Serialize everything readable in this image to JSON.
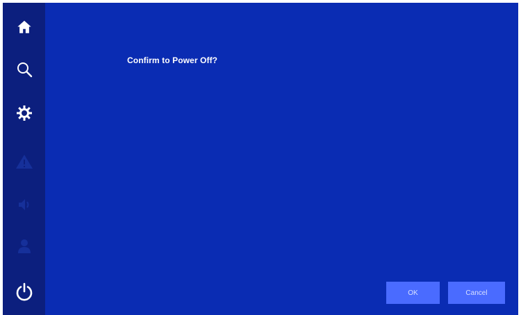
{
  "sidebar": {
    "items": [
      {
        "icon": "home-icon",
        "state": "active"
      },
      {
        "icon": "search-icon",
        "state": "active"
      },
      {
        "icon": "gear-icon",
        "state": "active"
      },
      {
        "icon": "warning-icon",
        "state": "dimmed"
      },
      {
        "icon": "speaker-icon",
        "state": "dimmed"
      },
      {
        "icon": "user-icon",
        "state": "dimmed"
      },
      {
        "icon": "power-icon",
        "state": "active"
      }
    ]
  },
  "dialog": {
    "message": "Confirm to Power Off?",
    "ok_label": "OK",
    "cancel_label": "Cancel"
  },
  "colors": {
    "background": "#0a2cb3",
    "sidebar": "#0c1f7e",
    "button": "#4a6bff",
    "icon_active": "#ffffff",
    "icon_dimmed": "#1a3399"
  }
}
